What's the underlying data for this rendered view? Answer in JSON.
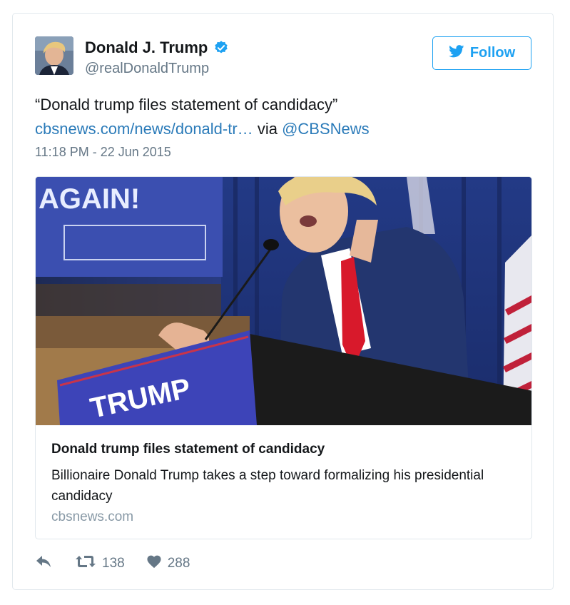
{
  "tweet": {
    "author_name": "Donald J. Trump",
    "author_handle": "@realDonaldTrump",
    "follow_label": "Follow",
    "text_quote": "“Donald trump files statement of candidacy”",
    "link_text": "cbsnews.com/news/donald-tr…",
    "via_text": "via",
    "mention": "@CBSNews",
    "timestamp": "11:18 PM - 22 Jun 2015"
  },
  "card": {
    "image_signs": {
      "banner": "AGAIN!",
      "podium": "TRUMP"
    },
    "title": "Donald trump files statement of candidacy",
    "description": "Billionaire Donald Trump takes a step toward formalizing his presidential candidacy",
    "domain": "cbsnews.com"
  },
  "actions": {
    "retweets": "138",
    "likes": "288"
  },
  "colors": {
    "accent": "#1da1f2",
    "link": "#2b7bb9",
    "muted": "#657786",
    "border": "#e1e8ed"
  },
  "icons": [
    "twitter-bird-icon",
    "verified-badge-icon",
    "reply-icon",
    "retweet-icon",
    "heart-icon"
  ]
}
